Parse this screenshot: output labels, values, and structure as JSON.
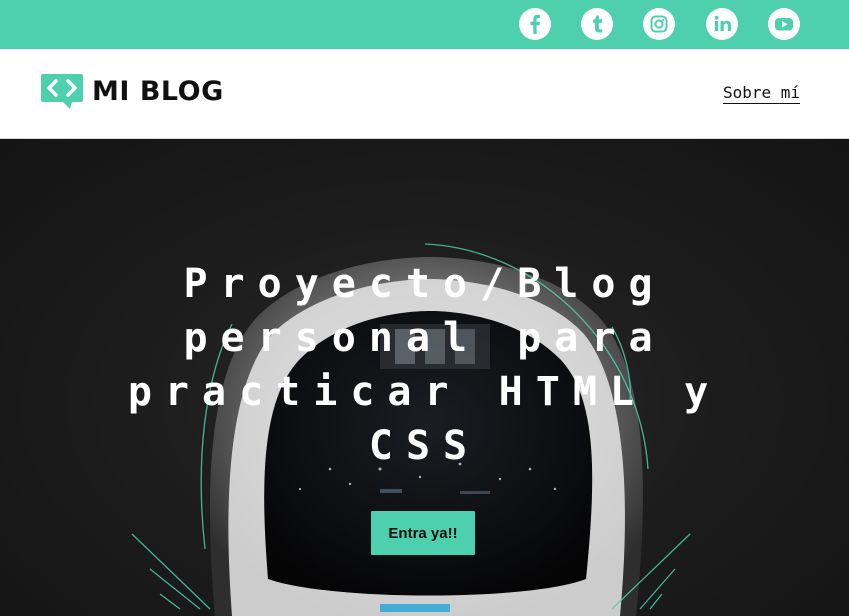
{
  "topbar": {
    "accent_color": "#4ecfae",
    "social": [
      {
        "icon": "facebook-icon"
      },
      {
        "icon": "tumblr-icon"
      },
      {
        "icon": "instagram-icon"
      },
      {
        "icon": "linkedin-icon"
      },
      {
        "icon": "youtube-icon"
      }
    ]
  },
  "header": {
    "logo_text": "MI BLOG",
    "nav_link": "Sobre mí"
  },
  "hero": {
    "title": "Proyecto/Blog personal para practicar HTML y CSS",
    "cta_label": "Entra ya!!"
  }
}
